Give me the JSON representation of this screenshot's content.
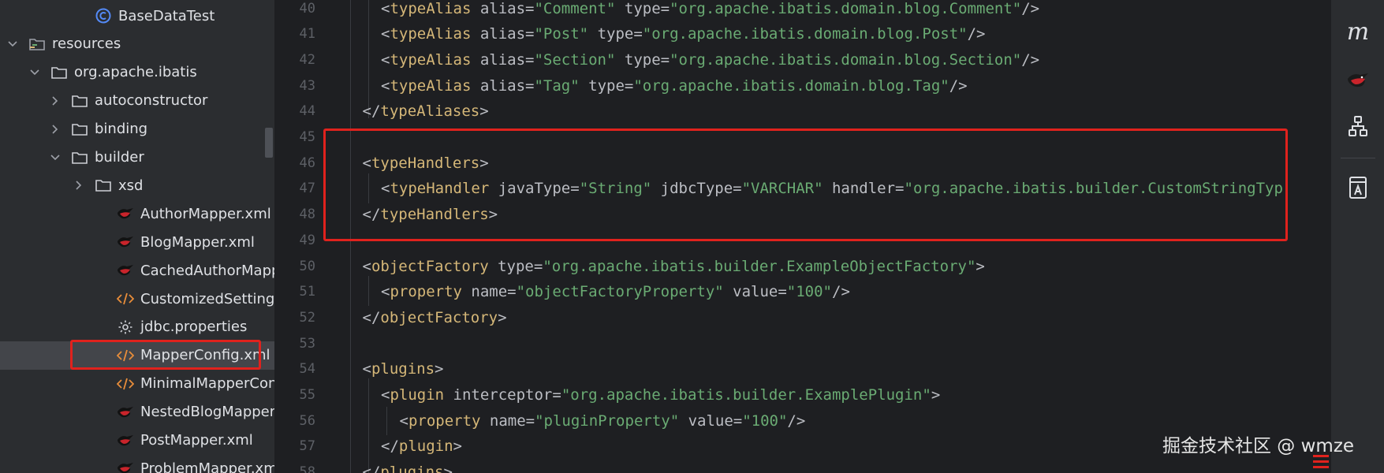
{
  "project_tree": {
    "items": [
      {
        "label": "BaseDataTest",
        "icon": "java-class-icon",
        "expanded": null
      },
      {
        "label": "resources",
        "icon": "resources-folder-icon",
        "expanded": true
      },
      {
        "label": "org.apache.ibatis",
        "icon": "folder-icon",
        "expanded": true
      },
      {
        "label": "autoconstructor",
        "icon": "folder-icon",
        "expanded": false
      },
      {
        "label": "binding",
        "icon": "folder-icon",
        "expanded": false
      },
      {
        "label": "builder",
        "icon": "folder-icon",
        "expanded": true
      },
      {
        "label": "xsd",
        "icon": "folder-icon",
        "expanded": false
      },
      {
        "label": "AuthorMapper.xml",
        "icon": "mybatis-icon",
        "expanded": null
      },
      {
        "label": "BlogMapper.xml",
        "icon": "mybatis-icon",
        "expanded": null
      },
      {
        "label": "CachedAuthorMapper.x",
        "icon": "mybatis-icon",
        "expanded": null
      },
      {
        "label": "CustomizedSettingsMa",
        "icon": "xml-icon",
        "expanded": null
      },
      {
        "label": "jdbc.properties",
        "icon": "gear-icon",
        "expanded": null
      },
      {
        "label": "MapperConfig.xml",
        "icon": "xml-icon",
        "expanded": null,
        "selected": true
      },
      {
        "label": "MinimalMapperConfig.",
        "icon": "xml-icon",
        "expanded": null
      },
      {
        "label": "NestedBlogMapper.xm",
        "icon": "mybatis-icon",
        "expanded": null
      },
      {
        "label": "PostMapper.xml",
        "icon": "mybatis-icon",
        "expanded": null
      },
      {
        "label": "ProblemMapper.xml",
        "icon": "mybatis-icon",
        "expanded": null
      }
    ]
  },
  "editor": {
    "lines": [
      {
        "num": "40",
        "tokens": [
          [
            "punct",
            "<"
          ],
          [
            "tag",
            "typeAlias"
          ],
          [
            "attr",
            " alias="
          ],
          [
            "val",
            "\"Comment\""
          ],
          [
            "attr",
            " type="
          ],
          [
            "val",
            "\"org.apache.ibatis.domain.blog.Comment\""
          ],
          [
            "punct",
            "/>"
          ]
        ]
      },
      {
        "num": "41",
        "tokens": [
          [
            "punct",
            "<"
          ],
          [
            "tag",
            "typeAlias"
          ],
          [
            "attr",
            " alias="
          ],
          [
            "val",
            "\"Post\""
          ],
          [
            "attr",
            " type="
          ],
          [
            "val",
            "\"org.apache.ibatis.domain.blog.Post\""
          ],
          [
            "punct",
            "/>"
          ]
        ]
      },
      {
        "num": "42",
        "tokens": [
          [
            "punct",
            "<"
          ],
          [
            "tag",
            "typeAlias"
          ],
          [
            "attr",
            " alias="
          ],
          [
            "val",
            "\"Section\""
          ],
          [
            "attr",
            " type="
          ],
          [
            "val",
            "\"org.apache.ibatis.domain.blog.Section\""
          ],
          [
            "punct",
            "/>"
          ]
        ]
      },
      {
        "num": "43",
        "tokens": [
          [
            "punct",
            "<"
          ],
          [
            "tag",
            "typeAlias"
          ],
          [
            "attr",
            " alias="
          ],
          [
            "val",
            "\"Tag\""
          ],
          [
            "attr",
            " type="
          ],
          [
            "val",
            "\"org.apache.ibatis.domain.blog.Tag\""
          ],
          [
            "punct",
            "/>"
          ]
        ]
      },
      {
        "num": "44",
        "tokens": [
          [
            "punct",
            "</"
          ],
          [
            "tag",
            "typeAliases"
          ],
          [
            "punct",
            ">"
          ]
        ]
      },
      {
        "num": "45",
        "tokens": []
      },
      {
        "num": "46",
        "tokens": [
          [
            "punct",
            "<"
          ],
          [
            "tag",
            "typeHandlers"
          ],
          [
            "punct",
            ">"
          ]
        ]
      },
      {
        "num": "47",
        "tokens": [
          [
            "punct",
            "<"
          ],
          [
            "tag",
            "typeHandler"
          ],
          [
            "attr",
            " javaType="
          ],
          [
            "val",
            "\"String\""
          ],
          [
            "attr",
            " jdbcType="
          ],
          [
            "val",
            "\"VARCHAR\""
          ],
          [
            "attr",
            " handler="
          ],
          [
            "val",
            "\"org.apache.ibatis.builder.CustomStringTyp"
          ]
        ]
      },
      {
        "num": "48",
        "tokens": [
          [
            "punct",
            "</"
          ],
          [
            "tag",
            "typeHandlers"
          ],
          [
            "punct",
            ">"
          ]
        ]
      },
      {
        "num": "49",
        "tokens": []
      },
      {
        "num": "50",
        "tokens": [
          [
            "punct",
            "<"
          ],
          [
            "tag",
            "objectFactory"
          ],
          [
            "attr",
            " type="
          ],
          [
            "val",
            "\"org.apache.ibatis.builder.ExampleObjectFactory\""
          ],
          [
            "punct",
            ">"
          ]
        ]
      },
      {
        "num": "51",
        "tokens": [
          [
            "punct",
            "<"
          ],
          [
            "tag",
            "property"
          ],
          [
            "attr",
            " name="
          ],
          [
            "val",
            "\"objectFactoryProperty\""
          ],
          [
            "attr",
            " value="
          ],
          [
            "val",
            "\"100\""
          ],
          [
            "punct",
            "/>"
          ]
        ]
      },
      {
        "num": "52",
        "tokens": [
          [
            "punct",
            "</"
          ],
          [
            "tag",
            "objectFactory"
          ],
          [
            "punct",
            ">"
          ]
        ]
      },
      {
        "num": "53",
        "tokens": []
      },
      {
        "num": "54",
        "tokens": [
          [
            "punct",
            "<"
          ],
          [
            "tag",
            "plugins"
          ],
          [
            "punct",
            ">"
          ]
        ]
      },
      {
        "num": "55",
        "tokens": [
          [
            "punct",
            "<"
          ],
          [
            "tag",
            "plugin"
          ],
          [
            "attr",
            " interceptor="
          ],
          [
            "val",
            "\"org.apache.ibatis.builder.ExamplePlugin\""
          ],
          [
            "punct",
            ">"
          ]
        ]
      },
      {
        "num": "56",
        "tokens": [
          [
            "punct",
            "<"
          ],
          [
            "tag",
            "property"
          ],
          [
            "attr",
            " name="
          ],
          [
            "val",
            "\"pluginProperty\""
          ],
          [
            "attr",
            " value="
          ],
          [
            "val",
            "\"100\""
          ],
          [
            "punct",
            "/>"
          ]
        ]
      },
      {
        "num": "57",
        "tokens": [
          [
            "punct",
            "</"
          ],
          [
            "tag",
            "plugin"
          ],
          [
            "punct",
            ">"
          ]
        ]
      },
      {
        "num": "58",
        "tokens": [
          [
            "punct",
            "</"
          ],
          [
            "tag",
            "plugins"
          ],
          [
            "punct",
            ">"
          ]
        ]
      }
    ]
  },
  "right_toolbar": {
    "items": [
      {
        "name": "maven-m-icon",
        "text": "m"
      },
      {
        "name": "mybatis-bird-icon"
      },
      {
        "name": "structure-hierarchy-icon"
      },
      {
        "name": "translate-book-icon"
      }
    ]
  },
  "watermark": {
    "text": "掘金技术社区 @ wmze"
  },
  "colors": {
    "tag": "#d5b778",
    "value": "#6aab73",
    "highlight": "#e0221d",
    "editor_bg": "#1e1f22",
    "panel_bg": "#2b2d30"
  }
}
